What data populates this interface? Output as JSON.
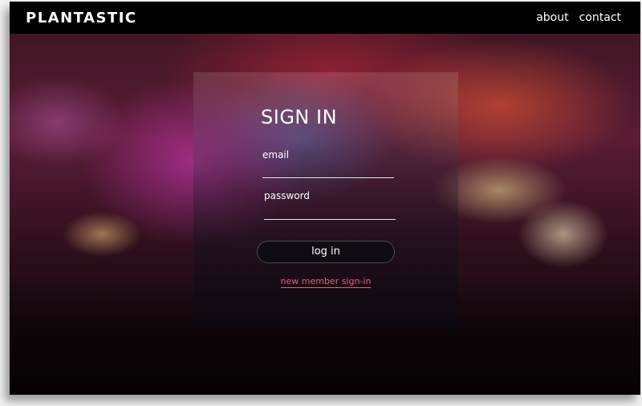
{
  "brand": {
    "logo": "PLANTASTIC"
  },
  "nav": {
    "items": [
      "about",
      "contact"
    ]
  },
  "signin": {
    "title": "SIGN IN",
    "email_label": "email",
    "password_label": "password",
    "login_label": "log in",
    "signup_label": "new member sign-in"
  },
  "colors": {
    "accent": "#e0627f",
    "topbar": "#000000"
  }
}
